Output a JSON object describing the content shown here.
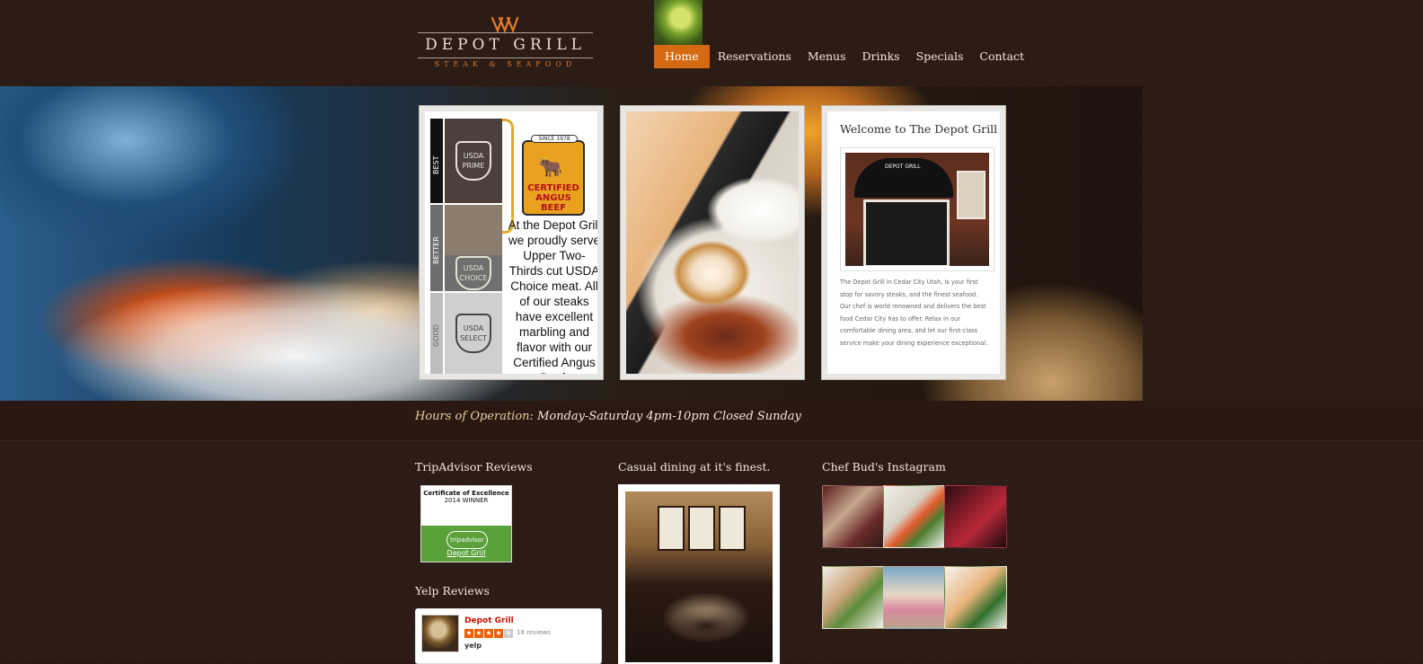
{
  "brand": {
    "logo_title": "DEPOT GRILL",
    "logo_subtitle": "STEAK & SEAFOOD",
    "accent_color": "#d56a12"
  },
  "nav": {
    "items": [
      {
        "label": "Home",
        "active": true
      },
      {
        "label": "Reservations",
        "active": false
      },
      {
        "label": "Menus",
        "active": false
      },
      {
        "label": "Drinks",
        "active": false
      },
      {
        "label": "Specials",
        "active": false
      },
      {
        "label": "Contact",
        "active": false
      }
    ]
  },
  "hero": {
    "beef_card": {
      "tiers": {
        "best": "BEST",
        "better": "BETTER",
        "good": "GOOD"
      },
      "grades": {
        "prime": "USDA PRIME",
        "choice": "USDA CHOICE",
        "select": "USDA SELECT"
      },
      "since": "SINCE 1978",
      "cab_brand": "CERTIFIED ANGUS BEEF",
      "text": "At the Depot Grill we proudly serve Upper Two-Thirds cut USDA Choice meat. All of our steaks have excellent marbling and flavor with our Certified Angus Beef."
    },
    "welcome_card": {
      "title": "Welcome to The Depot Grill",
      "awning_text": "DEPOT GRILL",
      "text": "The Depot Grill in Cedar City Utah, is your first stop for savory steaks, and the finest seafood. Our chef is world renowned and delivers the best food Cedar City has to offer. Relax in our comfortable dining area, and let our first-class service make your dining experience exceptional."
    }
  },
  "hours": {
    "label": "Hours of Operation:",
    "value": "Monday-Saturday 4pm-10pm Closed Sunday"
  },
  "sections": {
    "tripadvisor_title": "TripAdvisor Reviews",
    "tripadvisor_badge": {
      "line1": "Certificate of Excellence",
      "line2": "2014 WINNER",
      "brand": "tripadvisor",
      "link": "Depot Grill"
    },
    "yelp_title": "Yelp Reviews",
    "yelp_card": {
      "name": "Depot Grill",
      "stars": 4,
      "reviews": "18 reviews",
      "logo": "yelp"
    },
    "casual_title": "Casual dining at it's finest.",
    "instagram_title": "Chef Bud's Instagram"
  }
}
